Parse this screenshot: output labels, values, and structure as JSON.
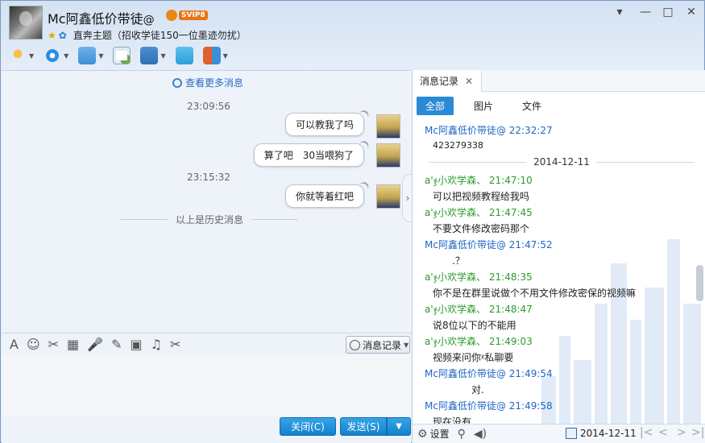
{
  "header": {
    "title": "Mc阿鑫低价带徒",
    "title_suffix": "@",
    "badge": "SVIP8",
    "subtitle": "直奔主题（招收学徒150一位墨迹勿扰）",
    "window_controls": [
      "▾",
      "—",
      "□",
      "✕"
    ]
  },
  "toolbar": {
    "items": [
      {
        "name": "microphone-icon",
        "color": "#e0a020"
      },
      {
        "name": "webcam-icon",
        "color": "#2a8ee0"
      },
      {
        "name": "file-transfer-icon",
        "color": "#3b8fd8"
      },
      {
        "name": "new-message-icon",
        "color": "#6aa84f"
      },
      {
        "name": "remote-desktop-icon",
        "color": "#2f6fb8"
      },
      {
        "name": "screen-share-icon",
        "color": "#2ba0d8"
      },
      {
        "name": "app-grid-icon",
        "color": "#e06030"
      }
    ]
  },
  "chat": {
    "more_link": "查看更多消息",
    "messages": [
      {
        "time": "23:09:56",
        "text": "可以教我了吗"
      },
      {
        "time": "",
        "text": "算了吧　30当喂狗了"
      },
      {
        "time": "23:15:32",
        "text": "你就等着红吧"
      }
    ],
    "history_label": "以上是历史消息"
  },
  "input_bar": {
    "tools": [
      "A",
      "☺",
      "✂",
      "▦",
      "🎤",
      "✎",
      "▣",
      "♫",
      "✂"
    ],
    "history_button": "消息记录"
  },
  "actions": {
    "close": "关闭(C)",
    "send": "发送(S)"
  },
  "history_panel": {
    "tab": "消息记录",
    "filters": [
      "全部",
      "图片",
      "文件"
    ],
    "active_filter": "全部",
    "entries": [
      {
        "type": "head-blue",
        "text": "Mc阿鑫低价带徒@ 22:32:27"
      },
      {
        "type": "body",
        "text": "423279338"
      },
      {
        "type": "date",
        "text": "2014-12-11"
      },
      {
        "type": "head-green",
        "text": "a'ჯ小欢学森、 21:47:10"
      },
      {
        "type": "body",
        "text": "可以把视频教程给我吗"
      },
      {
        "type": "head-green",
        "text": "a'ჯ小欢学森、 21:47:45"
      },
      {
        "type": "body",
        "text": "不要文件修改密码那个"
      },
      {
        "type": "head-blue",
        "text": "Mc阿鑫低价带徒@ 21:47:52"
      },
      {
        "type": "body",
        "text": "　　.？"
      },
      {
        "type": "head-green",
        "text": "a'ჯ小欢学森、 21:48:35"
      },
      {
        "type": "body",
        "text": "你不是在群里说做个不用文件修改密保的视频嘛"
      },
      {
        "type": "head-green",
        "text": "a'ჯ小欢学森、 21:48:47"
      },
      {
        "type": "body",
        "text": "说8位以下的不能用"
      },
      {
        "type": "head-green",
        "text": "a'ჯ小欢学森、 21:49:03"
      },
      {
        "type": "body",
        "text": "视频来问你ᵡ私聊要"
      },
      {
        "type": "head-blue",
        "text": "Mc阿鑫低价带徒@ 21:49:54"
      },
      {
        "type": "body",
        "text": "　　　　对."
      },
      {
        "type": "head-blue",
        "text": "Mc阿鑫低价带徒@ 21:49:58"
      },
      {
        "type": "body",
        "text": "现在没有"
      }
    ],
    "footer": {
      "settings": "设置",
      "date": "2014-12-11"
    }
  }
}
